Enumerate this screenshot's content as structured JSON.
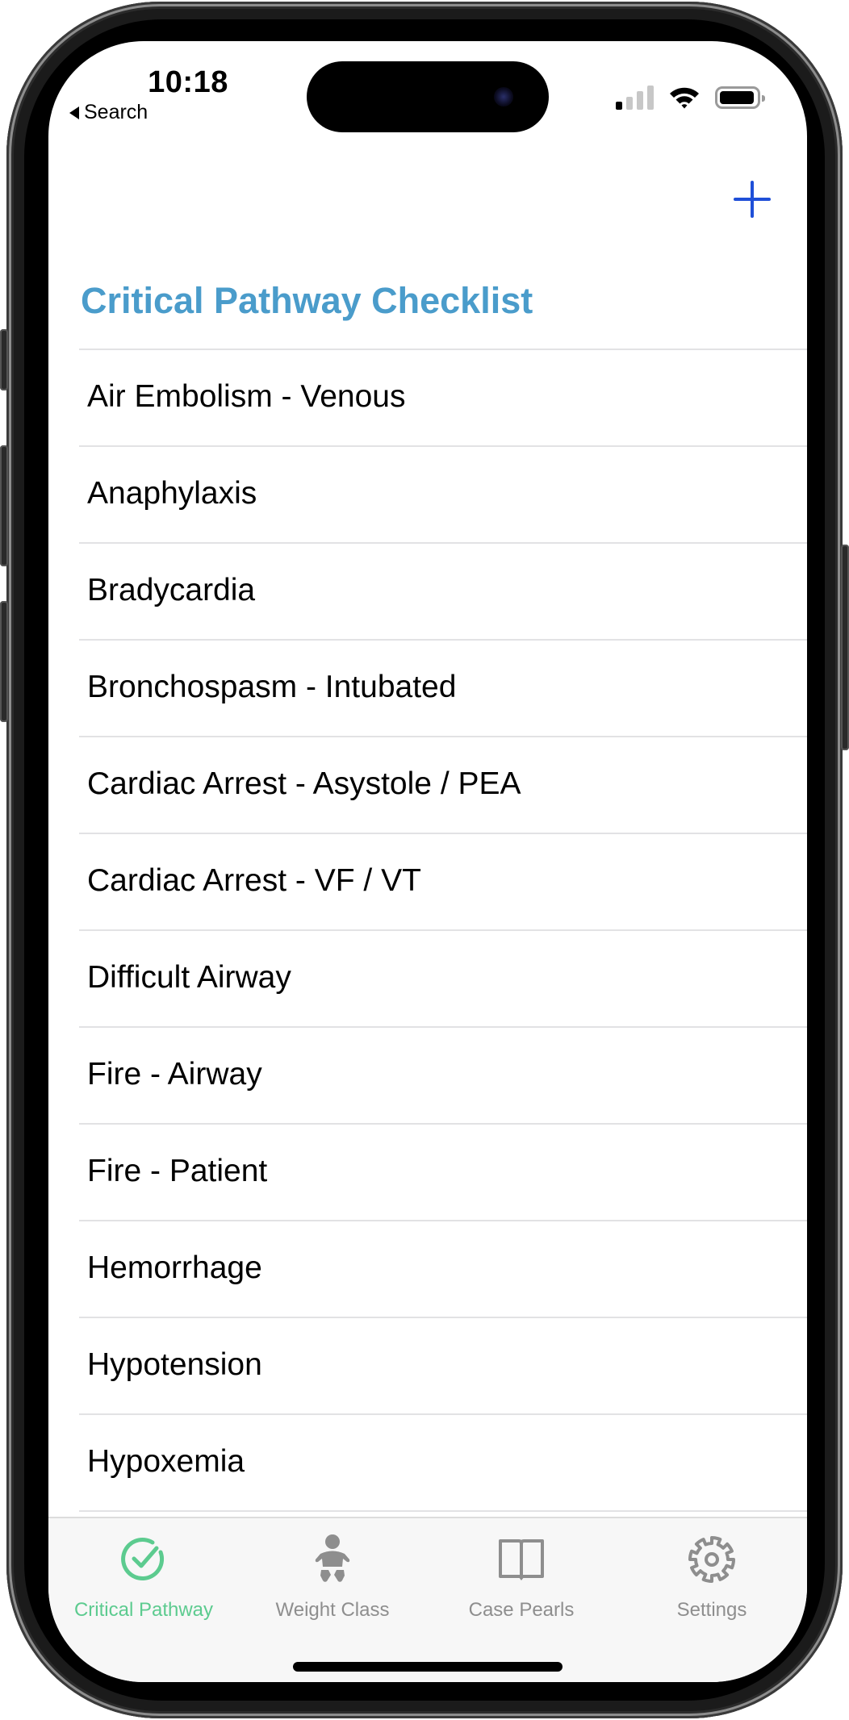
{
  "status_bar": {
    "time": "10:18",
    "back_label": "Search",
    "signal_bars_on": 1,
    "signal_bars_total": 4,
    "wifi": "wifi-icon",
    "battery_level": 0.95
  },
  "nav": {
    "add_icon": "plus-icon",
    "title": "Critical Pathway Checklist"
  },
  "list": {
    "items": [
      "Air Embolism - Venous",
      "Anaphylaxis",
      "Bradycardia",
      "Bronchospasm - Intubated",
      "Cardiac Arrest - Asystole / PEA",
      "Cardiac Arrest - VF / VT",
      "Difficult Airway",
      "Fire - Airway",
      "Fire - Patient",
      "Hemorrhage",
      "Hypotension",
      "Hypoxemia"
    ]
  },
  "tabbar": {
    "tabs": [
      {
        "label": "Critical Pathway",
        "icon": "checkmark-circle-icon",
        "active": true
      },
      {
        "label": "Weight Class",
        "icon": "baby-icon",
        "active": false
      },
      {
        "label": "Case Pearls",
        "icon": "book-icon",
        "active": false
      },
      {
        "label": "Settings",
        "icon": "gear-icon",
        "active": false
      }
    ]
  },
  "colors": {
    "title": "#4a9ccb",
    "accent_plus": "#1f4fd8",
    "tab_active": "#5ccb8f",
    "tab_inactive": "#8e8e8e"
  }
}
